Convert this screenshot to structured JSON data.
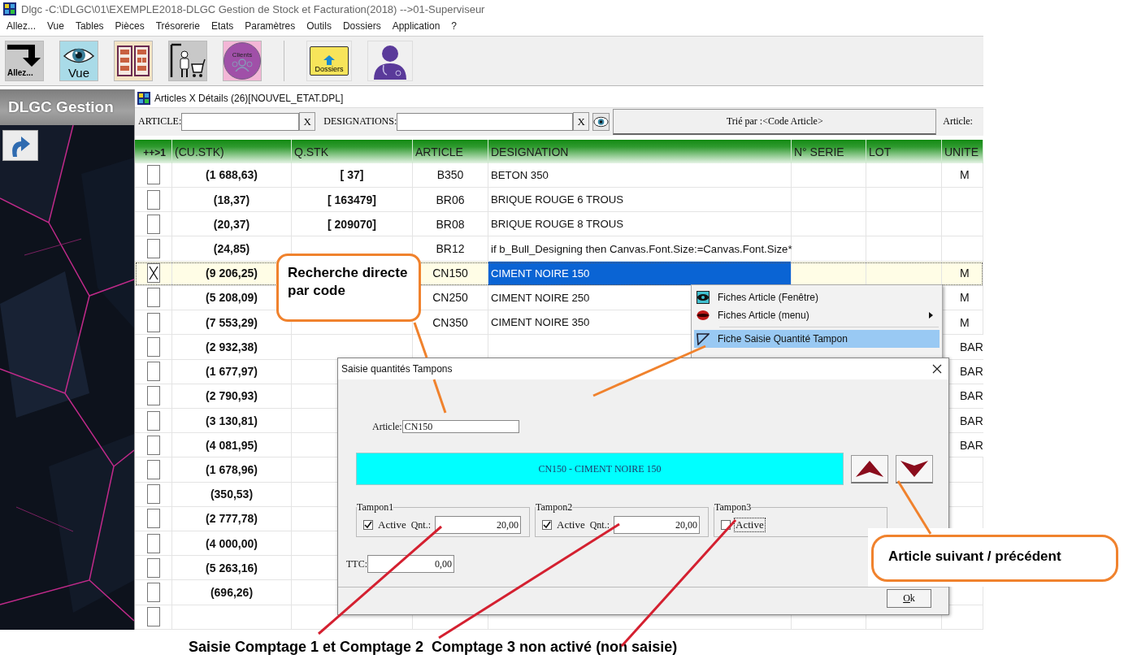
{
  "window": {
    "title": "Dlgc -C:\\DLGC\\01\\EXEMPLE2018-DLGC Gestion de Stock et Facturation(2018) -->01-Superviseur"
  },
  "menu": [
    "Allez...",
    "Vue",
    "Tables",
    "Pièces",
    "Trésorerie",
    "Etats",
    "Paramètres",
    "Outils",
    "Dossiers",
    "Application",
    "?"
  ],
  "toolbar": [
    {
      "kind": "goto",
      "label": "Allez..."
    },
    {
      "kind": "view",
      "label": "Vue"
    },
    {
      "kind": "tables"
    },
    {
      "kind": "stock"
    },
    {
      "kind": "clients",
      "label": "Clients"
    },
    {
      "kind": "separator"
    },
    {
      "kind": "folders",
      "label": "Dossiers"
    },
    {
      "kind": "user"
    }
  ],
  "side_panel": {
    "title": "DLGC Gestion"
  },
  "articles_window": {
    "title": "Articles X Détails (26)[NOUVEL_ETAT.DPL]",
    "filters": {
      "article_label": "ARTICLE:",
      "article_clear": "X",
      "designation_label": "DESIGNATIONS:",
      "designation_clear": "X",
      "sort_button": "Trié par :<Code Article>",
      "article_label_2": "Article:"
    },
    "columns": [
      "++>1",
      "(CU.STK)",
      "Q.STK",
      "ARTICLE",
      "DESIGNATION",
      "N° SERIE",
      "LOT",
      "UNITE"
    ],
    "rows": [
      {
        "checked": false,
        "selected": false,
        "cu": "(1 688,63)",
        "qstk": "[ 37]",
        "article": "B350",
        "designation": "BETON 350",
        "unite": "M"
      },
      {
        "checked": false,
        "selected": false,
        "cu": "(18,37)",
        "qstk": "[ 163479]",
        "article": "BR06",
        "designation": "BRIQUE ROUGE 6 TROUS"
      },
      {
        "checked": false,
        "selected": false,
        "cu": "(20,37)",
        "qstk": "[ 209070]",
        "article": "BR08",
        "designation": "BRIQUE ROUGE 8 TROUS"
      },
      {
        "checked": false,
        "selected": false,
        "cu": "(24,85)",
        "article": "BR12",
        "designation": "if b_Bull_Designing then  Canvas.Font.Size:=Canvas.Font.Size*"
      },
      {
        "checked": true,
        "selected": true,
        "cu": "(9 206,25)",
        "article": "CN150",
        "designation": "CIMENT NOIRE 150",
        "unite": "M"
      },
      {
        "checked": false,
        "selected": false,
        "cu": "(5 208,09)",
        "article": "CN250",
        "designation": "CIMENT NOIRE 250",
        "unite": "M"
      },
      {
        "checked": false,
        "selected": false,
        "cu": "(7 553,29)",
        "article": "CN350",
        "designation": "CIMENT NOIRE 350",
        "unite": "M"
      },
      {
        "checked": false,
        "selected": false,
        "cu": "(2 932,38)",
        "unite": "BAR"
      },
      {
        "checked": false,
        "selected": false,
        "cu": "(1 677,97)",
        "unite": "BAR"
      },
      {
        "checked": false,
        "selected": false,
        "cu": "(2 790,93)",
        "unite": "BAR"
      },
      {
        "checked": false,
        "selected": false,
        "cu": "(3 130,81)",
        "unite": "BAR"
      },
      {
        "checked": false,
        "selected": false,
        "cu": "(4 081,95)",
        "unite": "BAR"
      },
      {
        "checked": false,
        "selected": false,
        "cu": "(1 678,96)"
      },
      {
        "checked": false,
        "selected": false,
        "cu": "(350,53)"
      },
      {
        "checked": false,
        "selected": false,
        "cu": "(2 777,78)"
      },
      {
        "checked": false,
        "selected": false,
        "cu": "(4 000,00)"
      },
      {
        "checked": false,
        "selected": false,
        "cu": "(5 263,16)"
      },
      {
        "checked": false,
        "selected": false,
        "cu": "(696,26)"
      },
      {
        "checked": false,
        "selected": false
      }
    ]
  },
  "context_menu": {
    "items": [
      {
        "kind": "item",
        "label": "Fiches Article (Fenêtre)",
        "submenu": false,
        "selected": false
      },
      {
        "kind": "item",
        "label": "Fiches Article (menu)",
        "submenu": true,
        "selected": false
      },
      {
        "kind": "separator"
      },
      {
        "kind": "item",
        "label": "Fiche Saisie Quantité Tampon",
        "submenu": false,
        "selected": true
      }
    ]
  },
  "dialog": {
    "title": "Saisie quantités Tampons",
    "article_label": "Article:",
    "article_value": "CN150",
    "banner": "CN150 - CIMENT NOIRE 150",
    "groups": [
      {
        "title": "Tampon1",
        "active_label": "Active",
        "checked": true,
        "focused": false,
        "qty_label": "Qnt.:",
        "qty": "20,00"
      },
      {
        "title": "Tampon2",
        "active_label": "Active",
        "checked": true,
        "focused": false,
        "qty_label": "Qnt.:",
        "qty": "20,00"
      },
      {
        "title": "Tampon3",
        "active_label": "Active",
        "checked": false,
        "focused": true
      }
    ],
    "ttc_label": "TTC:",
    "ttc": "0,00",
    "ok": "Ok"
  },
  "annotations": [
    {
      "kind": "callout",
      "text": "Recherche directe par code"
    },
    {
      "kind": "callout",
      "text": "Article suivant / précédent"
    },
    {
      "kind": "caption",
      "text": "Saisie Comptage 1 et Comptage 2  Comptage 3 non activé (non saisie)"
    }
  ]
}
